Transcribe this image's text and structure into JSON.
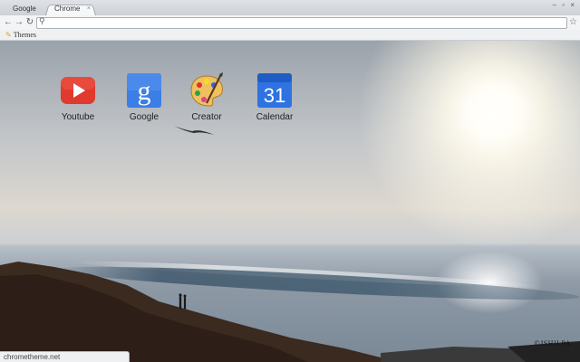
{
  "tabs": [
    {
      "label": "Google",
      "active": false
    },
    {
      "label": "Chrome",
      "active": true
    }
  ],
  "tab_close_icon": "close-icon",
  "window_controls": "– ▫ ×",
  "toolbar": {
    "back_icon": "←",
    "forward_icon": "→",
    "reload_icon": "↻",
    "omnibox_value": "",
    "star_icon": "☆"
  },
  "bookmarks": [
    {
      "label": "Themes",
      "icon": "themes-icon"
    }
  ],
  "apps": [
    {
      "label": "Youtube",
      "icon": "youtube-icon",
      "color": "#e03a2e"
    },
    {
      "label": "Google",
      "icon": "google-icon",
      "color": "#3a7ee6"
    },
    {
      "label": "Creator",
      "icon": "palette-icon",
      "color": "#e8b040"
    },
    {
      "label": "Calendar",
      "icon": "calendar-icon",
      "color": "#2f73e3",
      "text": "31"
    }
  ],
  "watermark": "©JSHILPA",
  "statusbar": "chrometheme.net"
}
